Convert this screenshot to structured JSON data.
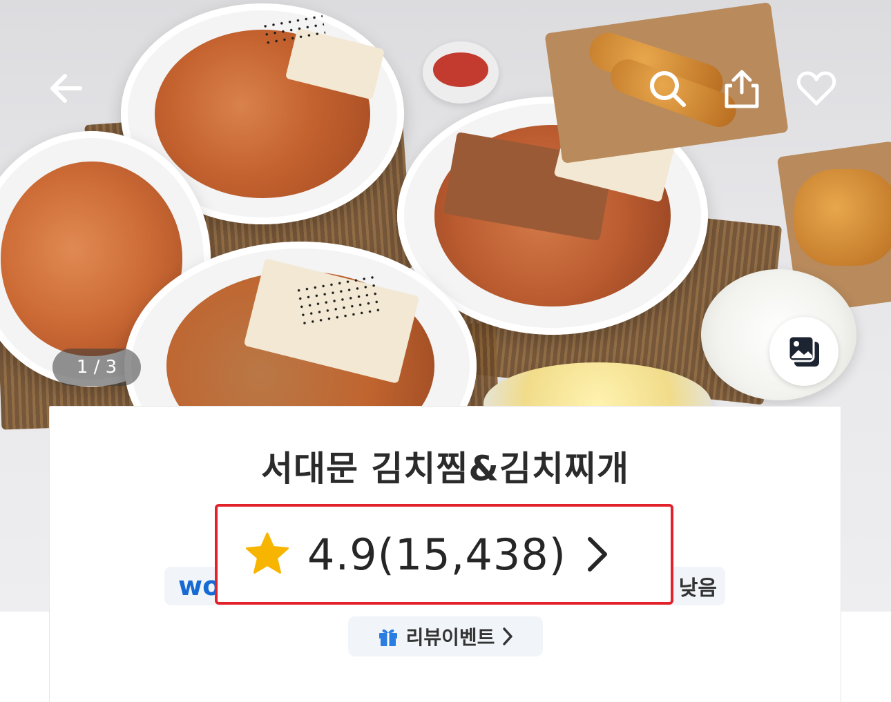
{
  "hero": {
    "page_indicator": "1 / 3",
    "icons": {
      "back": "arrow-left-icon",
      "search": "search-icon",
      "share": "share-icon",
      "favorite": "heart-icon",
      "gallery": "photo-gallery-icon"
    }
  },
  "store": {
    "name": "서대문 김치찜&김치찌개",
    "rating": "4.9",
    "review_count": "(15,438)",
    "rating_display": "4.9(15,438)",
    "badge_wow": "wo",
    "delivery_fee_tail": "낮음",
    "review_event_label": "리뷰이벤트"
  },
  "colors": {
    "highlight_border": "#e2212a",
    "star": "#f7b500",
    "wow_blue": "#1769d4",
    "chip_bg": "#f1f4f8"
  }
}
